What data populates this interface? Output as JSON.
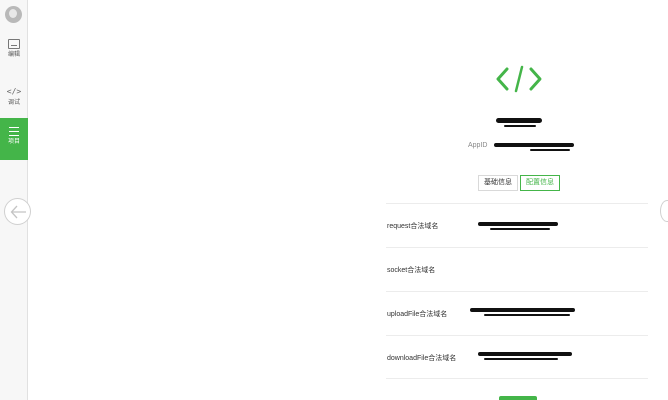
{
  "sidebar": {
    "items": [
      {
        "label": "编辑",
        "icon": "edit-icon"
      },
      {
        "label": "调试",
        "icon": "code-icon",
        "glyph": "</>"
      },
      {
        "label": "项目",
        "icon": "menu-icon",
        "active": true
      }
    ]
  },
  "project": {
    "appid_label": "AppID"
  },
  "tabs": [
    {
      "label": "基础信息",
      "active": false
    },
    {
      "label": "配置信息",
      "active": true
    }
  ],
  "domains": [
    {
      "label": "request合法域名"
    },
    {
      "label": "socket合法域名"
    },
    {
      "label": "uploadFile合法域名"
    },
    {
      "label": "downloadFile合法域名"
    }
  ],
  "colors": {
    "accent": "#44b549",
    "sidebar_bg": "#f7f7f7"
  }
}
